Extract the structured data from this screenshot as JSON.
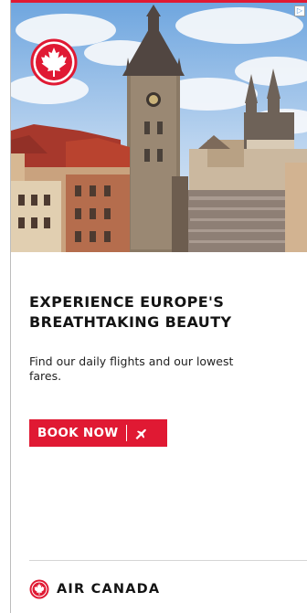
{
  "ad": {
    "headline_line1": "EXPERIENCE EUROPE'S",
    "headline_line2": "BREATHTAKING BEAUTY",
    "body": "Find our daily flights and our lowest fares.",
    "cta_label": "BOOK NOW",
    "brand_name": "AIR CANADA",
    "adchoices_symbol": "▷"
  },
  "icons": {
    "hero_logo": "maple-leaf-icon",
    "cta": "plane-icon",
    "brand": "maple-leaf-icon"
  },
  "colors": {
    "brand_red": "#e01933",
    "text": "#141414"
  }
}
